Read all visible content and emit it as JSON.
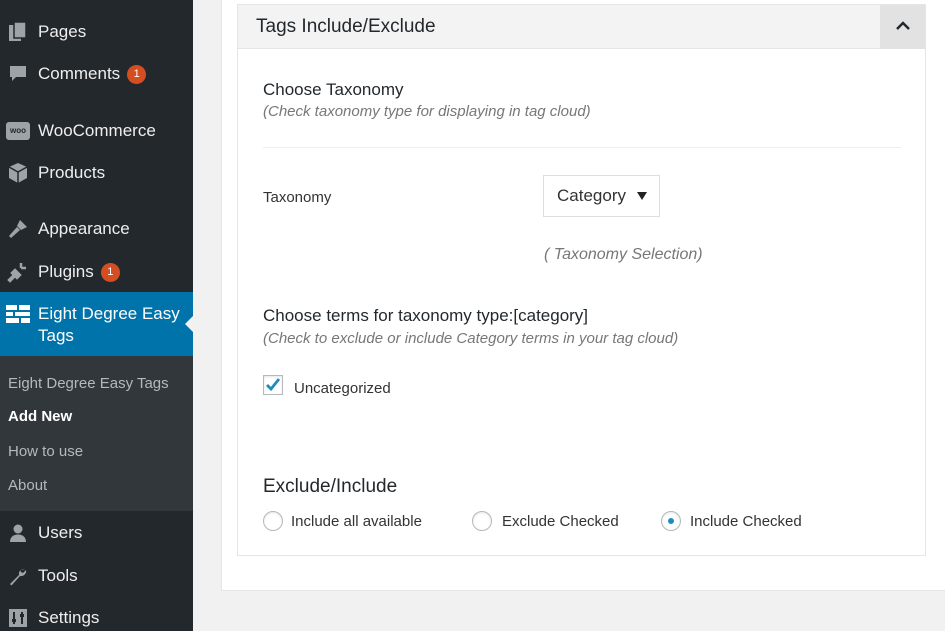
{
  "sidebar": {
    "items": [
      {
        "label": "Pages",
        "icon": "pages-icon"
      },
      {
        "label": "Comments",
        "icon": "comments-icon",
        "badge": "1"
      },
      {
        "label": "WooCommerce",
        "icon": "woocommerce-icon"
      },
      {
        "label": "Products",
        "icon": "products-icon"
      },
      {
        "label": "Appearance",
        "icon": "appearance-icon"
      },
      {
        "label": "Plugins",
        "icon": "plugins-icon",
        "badge": "1"
      },
      {
        "label": "Eight Degree Easy Tags",
        "icon": "tags-grid-icon",
        "active": true
      },
      {
        "label": "Users",
        "icon": "users-icon"
      },
      {
        "label": "Tools",
        "icon": "tools-icon"
      },
      {
        "label": "Settings",
        "icon": "settings-icon"
      }
    ],
    "submenu": [
      {
        "label": "Eight Degree Easy Tags"
      },
      {
        "label": "Add New",
        "current": true
      },
      {
        "label": "How to use"
      },
      {
        "label": "About"
      }
    ],
    "woo_icon_text": "woo"
  },
  "postbox": {
    "title": "Tags Include/Exclude",
    "choose_taxonomy": {
      "title": "Choose Taxonomy",
      "hint": "(Check taxonomy type for displaying in tag cloud)"
    },
    "taxonomy": {
      "label": "Taxonomy",
      "selected": "Category",
      "note": "( Taxonomy Selection)"
    },
    "choose_terms": {
      "title": "Choose terms for taxonomy type:[category]",
      "hint": "(Check to exclude or include Category terms in your tag cloud)"
    },
    "terms": [
      {
        "label": "Uncategorized",
        "checked": true
      }
    ],
    "exclude_include": {
      "title": "Exclude/Include",
      "options": [
        {
          "label": "Include all available",
          "checked": false
        },
        {
          "label": "Exclude Checked",
          "checked": false
        },
        {
          "label": "Include Checked",
          "checked": true
        }
      ]
    }
  },
  "colors": {
    "sidebar_bg": "#23282d",
    "submenu_bg": "#32373c",
    "active_bg": "#0073aa",
    "badge": "#d54e21",
    "check_accent": "#1e8cbe"
  }
}
